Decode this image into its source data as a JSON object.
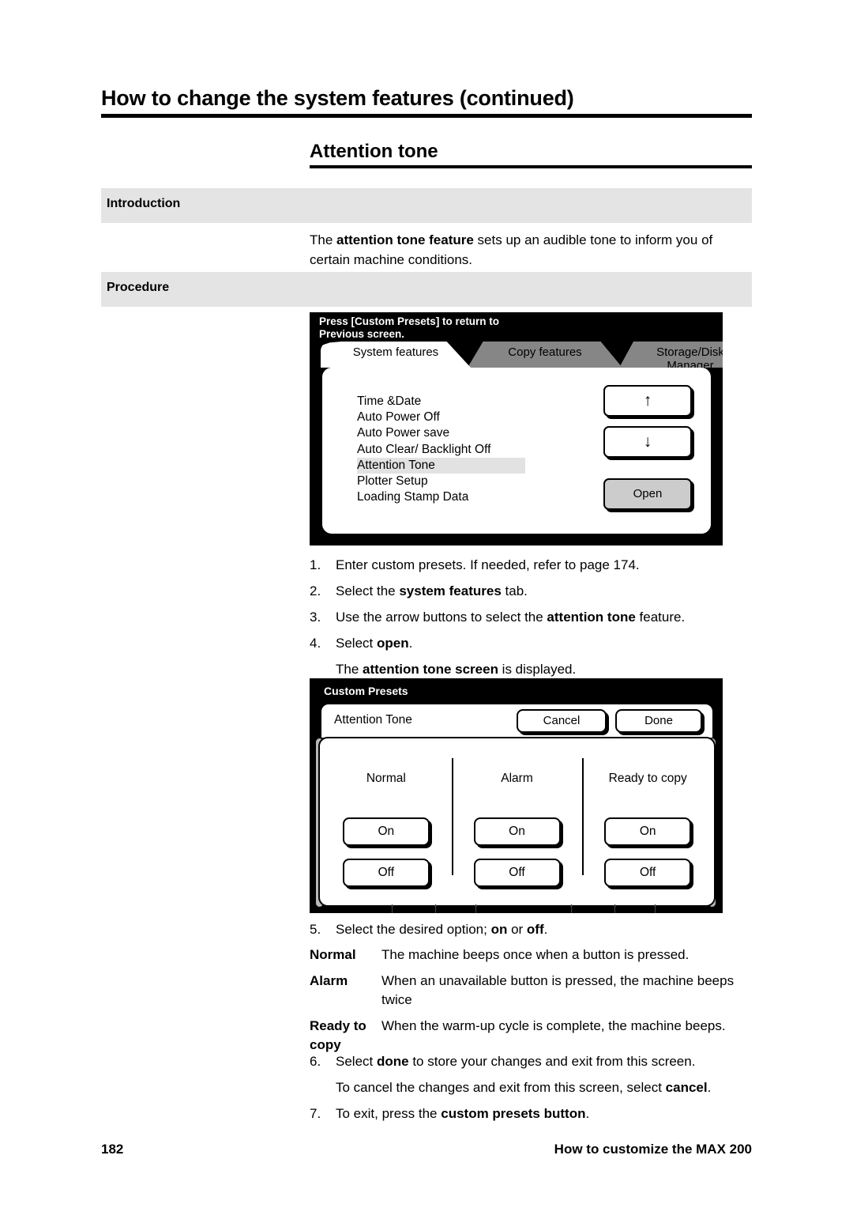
{
  "page": {
    "running_head": "How to change the system features (continued)",
    "section_title": "Attention tone",
    "footer_page_number": "182",
    "footer_title": "How to customize the MAX 200"
  },
  "bands": {
    "introduction": "Introduction",
    "procedure": "Procedure"
  },
  "introduction": {
    "paragraph_pre": "The ",
    "paragraph_bold": "attention tone feature",
    "paragraph_post": " sets up an audible tone to inform you of certain machine conditions."
  },
  "screen_system_features": {
    "banner_line1": "Press [Custom Presets] to return to",
    "banner_line2": "Previous screen.",
    "tabs": [
      {
        "label": "System features",
        "active": true
      },
      {
        "label": "Copy features",
        "active": false
      },
      {
        "label": "Storage/Disk Manager",
        "active": false
      }
    ],
    "tab3_line1": "Storage/Disk",
    "tab3_line2": "Manager",
    "feature_items": [
      {
        "label": "Time &Date",
        "selected": false
      },
      {
        "label": "Auto Power Off",
        "selected": false
      },
      {
        "label": "Auto Power save",
        "selected": false
      },
      {
        "label": "Auto Clear/ Backlight Off",
        "selected": false
      },
      {
        "label": "Attention Tone",
        "selected": true
      },
      {
        "label": "Plotter Setup",
        "selected": false
      },
      {
        "label": "Loading Stamp Data",
        "selected": false
      }
    ],
    "buttons": {
      "scroll_up": "↑",
      "scroll_down": "↓",
      "open": "Open"
    },
    "softkey_count": 6
  },
  "steps_first": [
    {
      "num": "1.",
      "pre": "Enter custom presets.  If needed, refer to page 174.",
      "bold": "",
      "post": ""
    },
    {
      "num": "2.",
      "pre": "Select the ",
      "bold": "system features",
      "post": " tab."
    },
    {
      "num": "3.",
      "pre": "Use the arrow buttons to select the ",
      "bold": "attention tone",
      "post": " feature."
    },
    {
      "num": "4.",
      "pre": "Select ",
      "bold": "open",
      "post": "."
    }
  ],
  "steps_first_note": {
    "pre": "The ",
    "bold": "attention tone screen",
    "post": " is displayed."
  },
  "screen_attention_tone": {
    "banner": "Custom Presets",
    "title": "Attention Tone",
    "cancel_label": "Cancel",
    "done_label": "Done",
    "columns": [
      {
        "heading": "Normal",
        "on_label": "On",
        "off_label": "Off"
      },
      {
        "heading": "Alarm",
        "on_label": "On",
        "off_label": "Off"
      },
      {
        "heading": "Ready to copy",
        "on_label": "On",
        "off_label": "Off"
      }
    ],
    "softkey_count": 6
  },
  "step5": {
    "num": "5.",
    "pre": "Select the desired option; ",
    "bold1": "on",
    "mid": " or ",
    "bold2": "off",
    "post": "."
  },
  "definitions": [
    {
      "term": "Normal",
      "term_line2": "",
      "desc": "The machine beeps once when a button is pressed."
    },
    {
      "term": "Alarm",
      "term_line2": "",
      "desc": "When an unavailable button is pressed, the machine beeps twice"
    },
    {
      "term": "Ready to",
      "term_line2": "copy",
      "desc": "When the warm-up cycle is complete, the machine beeps."
    }
  ],
  "step6": {
    "num": "6.",
    "pre": "Select ",
    "bold": "done",
    "post": " to store your changes and exit from this screen."
  },
  "step6_note": {
    "pre": "To cancel the changes and exit from this screen, select ",
    "bold": "cancel",
    "post": "."
  },
  "step7": {
    "num": "7.",
    "pre": "To exit, press the ",
    "bold": "custom presets button",
    "post": "."
  },
  "colors": {
    "band_gray": "#e4e4e4",
    "lcd_bezel": "#000000",
    "tab_inactive": "#868686",
    "list_highlight": "#e2e2e2",
    "open_button": "#cccccc"
  }
}
